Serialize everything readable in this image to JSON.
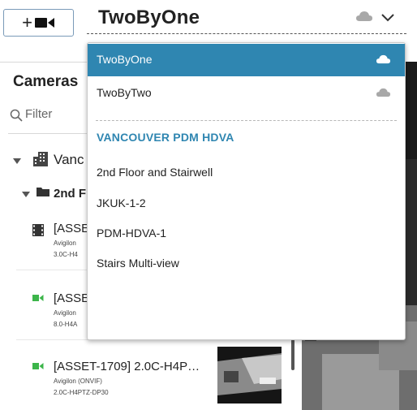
{
  "toolbar": {
    "add_camera_label": "+"
  },
  "header": {
    "view_title": "TwoByOne"
  },
  "cameras_panel": {
    "title": "Cameras",
    "filter_placeholder": "Filter",
    "site_label": "Vanc",
    "folder_label": "2nd F",
    "cameras": [
      {
        "name": "[ASSE",
        "line1": "Avigilon",
        "line2": "3.0C-H4",
        "icon": "film-icon",
        "icon_color": "#333333"
      },
      {
        "name": "[ASSE",
        "line1": "Avigilon",
        "line2": "8.0-H4A",
        "icon": "video-camera-icon",
        "icon_color": "#3cb54a"
      },
      {
        "name": "[ASSET-1709] 2.0C-H4P…",
        "line1": "Avigilon (ONVIF)",
        "line2": "2.0C-H4PTZ-DP30",
        "icon": "video-camera-icon",
        "icon_color": "#3cb54a"
      }
    ]
  },
  "dropdown": {
    "options": [
      {
        "label": "TwoByOne",
        "selected": true,
        "icon": "cloud-icon"
      },
      {
        "label": "TwoByTwo",
        "selected": false,
        "icon": "cloud-icon"
      }
    ],
    "section_header": "VANCOUVER PDM HDVA",
    "views": [
      "2nd Floor and Stairwell",
      "JKUK-1-2",
      "PDM-HDVA-1",
      "Stairs Multi-view"
    ]
  },
  "colors": {
    "accent": "#2f86b1",
    "online_green": "#3cb54a",
    "cloud_gray": "#a8a8a8"
  }
}
